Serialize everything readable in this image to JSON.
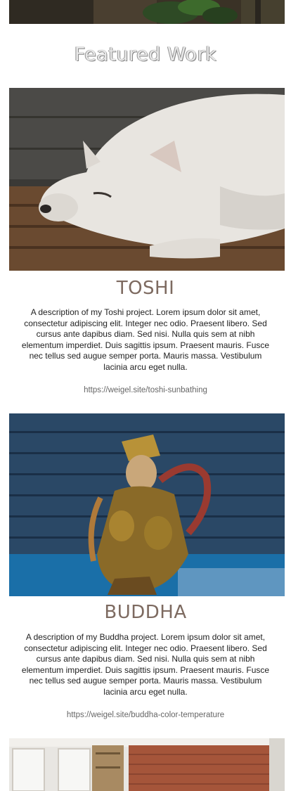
{
  "section": {
    "title": "Featured Work"
  },
  "projects": [
    {
      "title": "TOSHI",
      "description": "A description of my Toshi project. Lorem ipsum dolor sit amet, consectetur adipiscing elit. Integer nec odio. Praesent libero. Sed cursus ante dapibus diam. Sed nisi. Nulla quis sem at nibh elementum imperdiet. Duis sagittis ipsum. Praesent mauris. Fusce nec tellus sed augue semper porta. Mauris massa. Vestibulum lacinia arcu eget nulla.",
      "link": "https://weigel.site/toshi-sunbathing"
    },
    {
      "title": "BUDDHA",
      "description": "A description of my Buddha project. Lorem ipsum dolor sit amet, consectetur adipiscing elit. Integer nec odio. Praesent libero. Sed cursus ante dapibus diam. Sed nisi. Nulla quis sem at nibh elementum imperdiet. Duis sagittis ipsum. Praesent mauris. Fusce nec tellus sed augue semper porta. Mauris massa. Vestibulum lacinia arcu eget nulla.",
      "link": "https://weigel.site/buddha-color-temperature"
    }
  ],
  "colors": {
    "title_accent": "#7d6a60",
    "link": "#666666",
    "text": "#222222"
  }
}
